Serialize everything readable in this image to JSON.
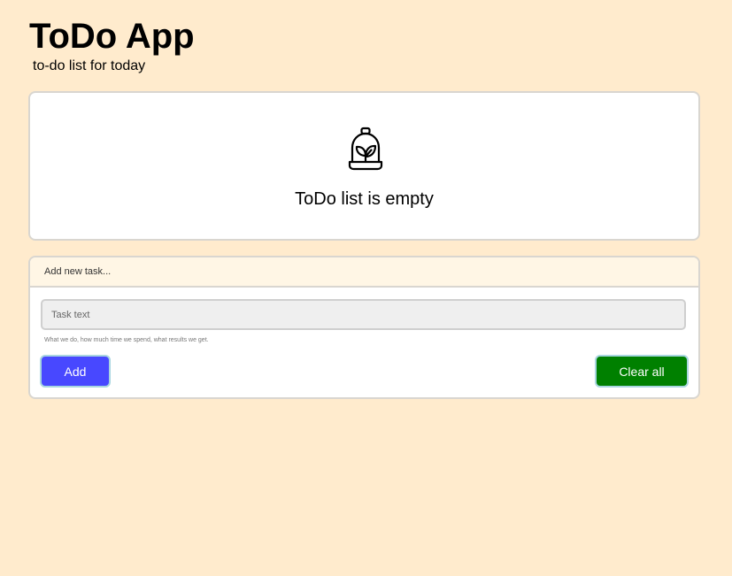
{
  "header": {
    "title": "ToDo App",
    "subtitle": "to-do list for today"
  },
  "empty_state": {
    "icon": "plant-in-jar-icon",
    "message": "ToDo list is empty"
  },
  "form": {
    "header_label": "Add new task...",
    "task_input": {
      "placeholder": "Task text",
      "value": ""
    },
    "help_text": "What we do, how much time we spend, what results we get.",
    "add_label": "Add",
    "clear_label": "Clear all"
  },
  "colors": {
    "background": "#ffebcd",
    "add_button": "#4848ff",
    "clear_button": "#008000",
    "form_header": "#fff6e5"
  }
}
